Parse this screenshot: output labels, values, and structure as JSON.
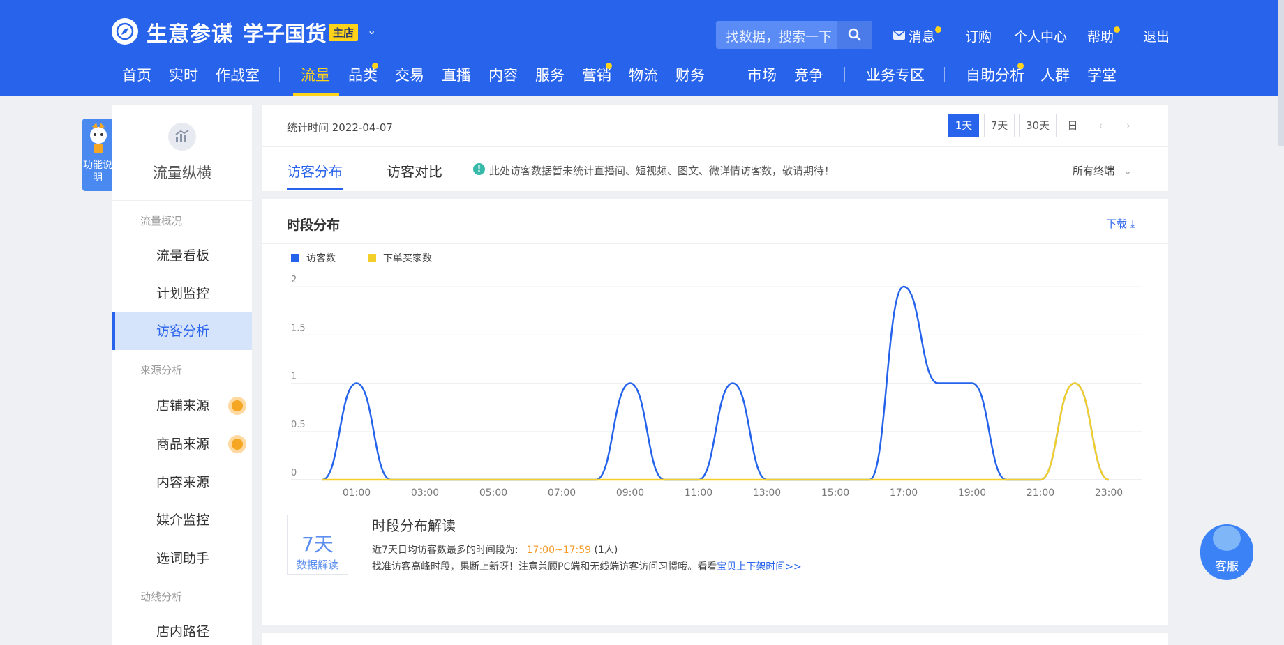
{
  "header": {
    "brand": "生意参谋",
    "shop_name": "学子国货",
    "shop_badge": "主店",
    "search_placeholder": "找数据，搜索一下",
    "links": [
      "消息",
      "订购",
      "个人中心",
      "帮助",
      "退出"
    ],
    "nav": [
      "首页",
      "实时",
      "作战室",
      "流量",
      "品类",
      "交易",
      "直播",
      "内容",
      "服务",
      "营销",
      "物流",
      "财务",
      "市场",
      "竞争",
      "业务专区",
      "自助分析",
      "人群",
      "学堂"
    ],
    "active_nav": "流量"
  },
  "helper": {
    "label": "功能说明"
  },
  "sidebar": {
    "title": "流量纵横",
    "groups": [
      {
        "label": "流量概况",
        "items": [
          "流量看板",
          "计划监控",
          "访客分析"
        ]
      },
      {
        "label": "来源分析",
        "items": [
          "店铺来源",
          "商品来源",
          "内容来源",
          "媒介监控",
          "选词助手"
        ]
      },
      {
        "label": "动线分析",
        "items": [
          "店内路径"
        ]
      }
    ],
    "active_item": "访客分析"
  },
  "toolbar": {
    "stat_time": "统计时间 2022-04-07",
    "ranges": [
      "1天",
      "7天",
      "30天",
      "日"
    ],
    "active_range": "1天"
  },
  "tabs": [
    "访客分布",
    "访客对比"
  ],
  "active_tab": "访客分布",
  "notice": "此处访客数据暂未统计直播间、短视频、图文、微详情访客数，敬请期待！",
  "terminal_select": "所有终端",
  "chart_card": {
    "title": "时段分布",
    "download": "下载"
  },
  "chart_data": {
    "type": "line",
    "x": [
      "00:00",
      "01:00",
      "02:00",
      "03:00",
      "04:00",
      "05:00",
      "06:00",
      "07:00",
      "08:00",
      "09:00",
      "10:00",
      "11:00",
      "12:00",
      "13:00",
      "14:00",
      "15:00",
      "16:00",
      "17:00",
      "18:00",
      "19:00",
      "20:00",
      "21:00",
      "22:00",
      "23:00"
    ],
    "xticks": [
      "01:00",
      "03:00",
      "05:00",
      "07:00",
      "09:00",
      "11:00",
      "13:00",
      "15:00",
      "17:00",
      "19:00",
      "21:00",
      "23:00"
    ],
    "series": [
      {
        "name": "访客数",
        "color": "#2563eb",
        "values": [
          0,
          1,
          0,
          0,
          0,
          0,
          0,
          0,
          0,
          1,
          0,
          0,
          1,
          0,
          0,
          0,
          0,
          2,
          1,
          1,
          0,
          0,
          1,
          0
        ]
      },
      {
        "name": "下单买家数",
        "color": "#f2cf2b",
        "values": [
          0,
          0,
          0,
          0,
          0,
          0,
          0,
          0,
          0,
          0,
          0,
          0,
          0,
          0,
          0,
          0,
          0,
          0,
          0,
          0,
          0,
          0,
          1,
          0
        ]
      }
    ],
    "yticks": [
      "0",
      "0.5",
      "1",
      "1.5",
      "2"
    ],
    "ylim": [
      0,
      2
    ],
    "grid": true,
    "legend": "top-left"
  },
  "interpretation": {
    "badge_big": "7天",
    "badge_small": "数据解读",
    "title": "时段分布解读",
    "line1_prefix": "近7天日均访客数最多的时间段为:",
    "line1_highlight": "17:00~17:59",
    "line1_suffix": "(1人)",
    "line2_text": "找准访客高峰时段，果断上新呀！注意兼顾PC端和无线端访客访问习惯哦。看看",
    "line2_link": "宝贝上下架时间>>"
  },
  "service": {
    "label": "客服"
  }
}
